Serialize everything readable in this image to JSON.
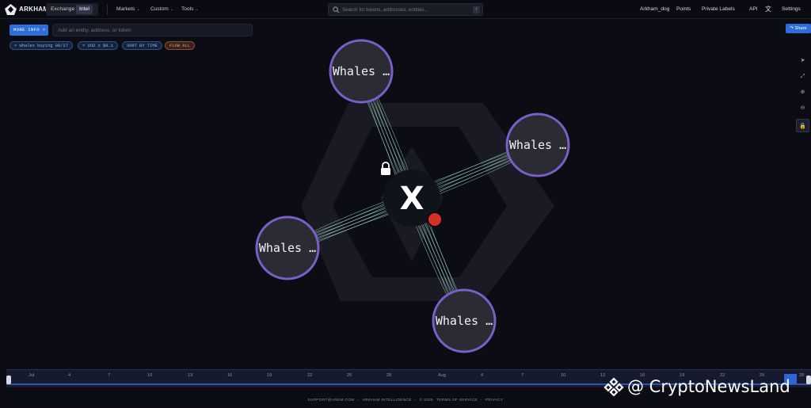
{
  "header": {
    "brand": "ARKHAM",
    "segments": {
      "exchange": "Exchange",
      "intel": "Intel",
      "active": "Intel"
    },
    "nav": [
      {
        "label": "Markets",
        "icon": "chevron-down-icon"
      },
      {
        "label": "Custom",
        "icon": "chevron-down-icon"
      },
      {
        "label": "Tools",
        "icon": "chevron-down-icon"
      }
    ],
    "search": {
      "placeholder": "Search for tokens, addresses, entities...",
      "shortcut": "/"
    },
    "right_nav": {
      "user": "Arkham_dog",
      "points": "Points",
      "private_labels": "Private Labels",
      "api": "API",
      "settings": "Settings"
    }
  },
  "controls": {
    "more_button": "MORE INFO >",
    "entity_placeholder": "Add an entity, address, or token",
    "share_button": "Share"
  },
  "filters": [
    {
      "label": "Whales buying 08/27",
      "style": "blue"
    },
    {
      "label": "USD ≥ $0.1",
      "style": "blue"
    },
    {
      "label": "SORT BY TIME",
      "style": "blue"
    },
    {
      "label": "FLOW ALL",
      "style": "orange"
    }
  ],
  "toolbar": [
    "cursor-icon",
    "fit-icon",
    "zoom-in-icon",
    "zoom-out-icon",
    "lock-icon"
  ],
  "graph": {
    "center": {
      "label": "X",
      "icon": "x-token-icon",
      "status_color": "#d93025"
    },
    "nodes": [
      {
        "label": "Whales …"
      },
      {
        "label": "Whales …"
      },
      {
        "label": "Whales …"
      },
      {
        "label": "Whales …"
      }
    ],
    "colors": {
      "node_fill": "#2a2b33",
      "node_stroke": "#7a5fc9",
      "flow": "#9fd8c4"
    }
  },
  "timeline": {
    "ticks": [
      "Jul",
      "4",
      "7",
      "10",
      "13",
      "16",
      "19",
      "22",
      "25",
      "28",
      "Aug",
      "4",
      "7",
      "10",
      "13",
      "16",
      "19",
      "22",
      "25",
      "28"
    ]
  },
  "footer": {
    "email": "SUPPORT@ARKM.COM",
    "company": "ARKHAM INTELLIGENCE",
    "copyright": "© 2025",
    "terms": "TERMS OF SERVICE",
    "privacy": "PRIVACY",
    "sep": "-"
  },
  "watermark": {
    "text": "@ CryptoNewsLand"
  }
}
